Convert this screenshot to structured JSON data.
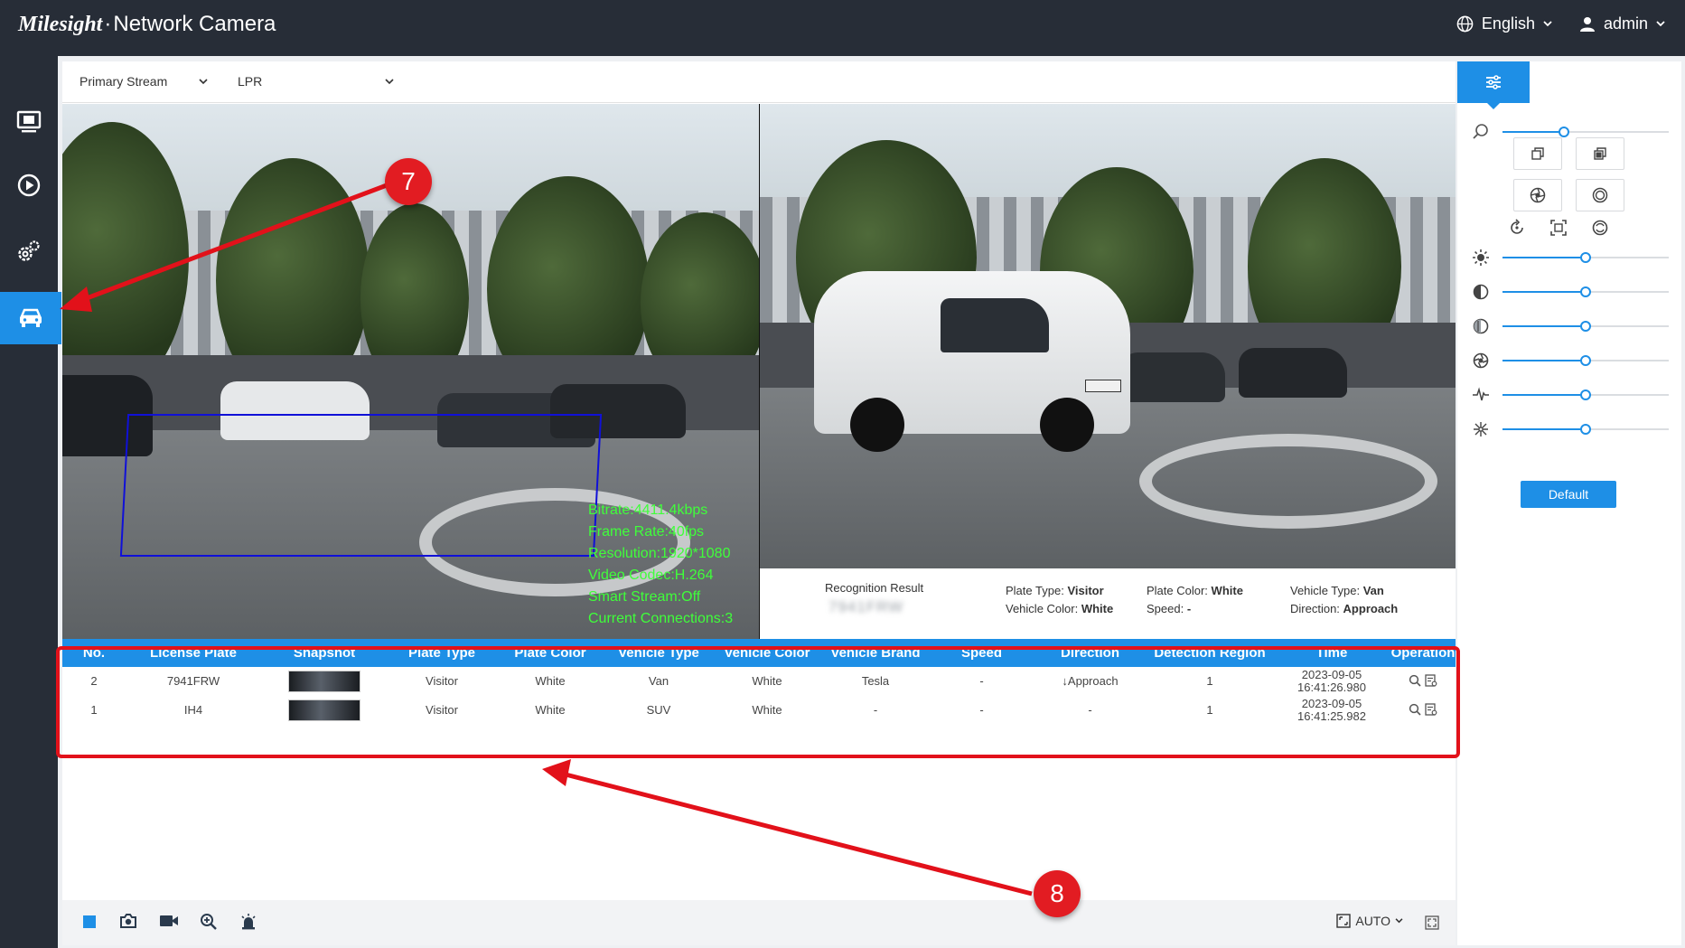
{
  "brand": {
    "logo": "Milesight",
    "separator": "·",
    "product": "Network Camera"
  },
  "header": {
    "language": "English",
    "user": "admin"
  },
  "stream": {
    "stream_select": "Primary Stream",
    "mode_select": "LPR"
  },
  "overlay": {
    "bitrate": "Bitrate:4411.4kbps",
    "frame_rate": "Frame Rate:40fps",
    "resolution": "Resolution:1920*1080",
    "video_codec": "Video Codec:H.264",
    "smart_stream": "Smart Stream:Off",
    "connections": "Current Connections:3"
  },
  "recognition": {
    "label": "Recognition Result",
    "plate": "7941FRW",
    "plate_type_label": "Plate Type:",
    "plate_type": "Visitor",
    "plate_color_label": "Plate Color:",
    "plate_color": "White",
    "vehicle_type_label": "Vehicle Type:",
    "vehicle_type": "Van",
    "vehicle_color_label": "Vehicle Color:",
    "vehicle_color": "White",
    "speed_label": "Speed:",
    "speed": "-",
    "direction_label": "Direction:",
    "direction": "Approach"
  },
  "table": {
    "headers": [
      "No.",
      "License Plate",
      "Snapshot",
      "Plate Type",
      "Plate Color",
      "Vehicle Type",
      "Vehicle Color",
      "Vehicle Brand",
      "Speed",
      "Direction",
      "Detection Region",
      "Time",
      "Operation"
    ],
    "rows": [
      {
        "no": "2",
        "plate": "7941FRW",
        "plate_type": "Visitor",
        "plate_color": "White",
        "vehicle_type": "Van",
        "vehicle_color": "White",
        "brand": "Tesla",
        "speed": "-",
        "direction": "↓Approach",
        "region": "1",
        "time_date": "2023-09-05",
        "time_clock": "16:41:26.980"
      },
      {
        "no": "1",
        "plate": "IH4",
        "plate_type": "Visitor",
        "plate_color": "White",
        "vehicle_type": "SUV",
        "vehicle_color": "White",
        "brand": "-",
        "speed": "-",
        "direction": "-",
        "region": "1",
        "time_date": "2023-09-05",
        "time_clock": "16:41:25.982"
      }
    ]
  },
  "annotations": {
    "callout_7": "7",
    "callout_8": "8"
  },
  "toolbar": {
    "zoom_mode": "AUTO"
  },
  "image_panel": {
    "default_button": "Default"
  },
  "sliders": {
    "zoom": 0.37,
    "brightness": 0.5,
    "contrast": 0.5,
    "saturation": 0.5,
    "aperture": 0.5,
    "sharpness": 0.5,
    "noise_reduction": 0.5
  },
  "colors": {
    "accent": "#1e8fe6",
    "topbar": "#272d37",
    "annotation_red": "#e2111a",
    "overlay_green": "#3fff3a"
  },
  "icons": [
    "monitor-icon",
    "playback-icon",
    "settings-icon",
    "vehicle-icon",
    "globe-icon",
    "user-icon",
    "sliders-icon",
    "zoom-icon",
    "brightness-icon",
    "contrast-icon",
    "saturation-icon",
    "aperture-icon",
    "sharpness-icon",
    "noise-icon",
    "snapshot-icon",
    "record-icon",
    "digital-zoom-icon",
    "alarm-icon",
    "fullscreen-icon"
  ]
}
